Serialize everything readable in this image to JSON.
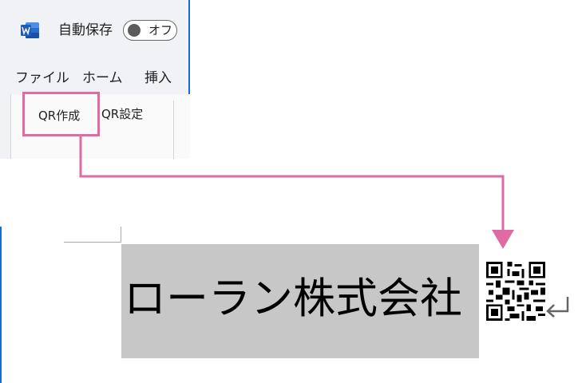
{
  "app": {
    "icon": "word-app-icon"
  },
  "autosave": {
    "label": "自動保存",
    "state": "オフ"
  },
  "tabs": [
    {
      "label": "ファイル"
    },
    {
      "label": "ホーム"
    },
    {
      "label": "挿入"
    }
  ],
  "ribbon": {
    "qr_create": "QR作成",
    "qr_settings": "QR設定"
  },
  "document": {
    "text": "ローラン株式会社",
    "qr_icon": "qr-code-image",
    "paragraph_mark": "return-arrow-icon"
  },
  "colors": {
    "highlight": "#e06aa2",
    "accent": "#1a6ad6",
    "selection": "#c7c7c7"
  }
}
